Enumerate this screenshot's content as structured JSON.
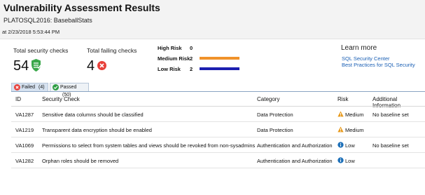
{
  "header": {
    "title": "Vulnerability Assessment Results",
    "database": "PLATOSQL2016: BaseballStats",
    "timestamp": "at 2/23/2018 5:53:44 PM"
  },
  "summary": {
    "total_checks_label": "Total security checks",
    "total_checks_value": "54",
    "failing_checks_label": "Total failing checks",
    "failing_checks_value": "4"
  },
  "risk_summary": [
    {
      "label": "High Risk",
      "count": "0",
      "color": "#e38a1e",
      "fraction": 0
    },
    {
      "label": "Medium Risk",
      "count": "2",
      "color": "#f0922a",
      "fraction": 1
    },
    {
      "label": "Low Risk",
      "count": "2",
      "color": "#1c1fb0",
      "fraction": 1
    }
  ],
  "learn_more": {
    "title": "Learn more",
    "links": [
      "SQL Security Center",
      "Best Practices for SQL Security"
    ]
  },
  "tabs": [
    {
      "label": "Failed",
      "count": "(4)",
      "icon": "fail-icon",
      "active": true
    },
    {
      "label": "Passed",
      "count": "(50)",
      "icon": "pass-icon",
      "active": false
    }
  ],
  "table": {
    "columns": [
      "ID",
      "Security Check",
      "Category",
      "Risk",
      "Additional Information"
    ],
    "rows": [
      {
        "id": "VA1287",
        "check": "Sensitive data columns should be classified",
        "category": "Data Protection",
        "risk": "Medium",
        "risk_icon": "warning-icon",
        "info": "No baseline set"
      },
      {
        "id": "VA1219",
        "check": "Transparent data encryption should be enabled",
        "category": "Data Protection",
        "risk": "Medium",
        "risk_icon": "warning-icon",
        "info": ""
      },
      {
        "id": "VA1069",
        "check": "Permissions to select from system tables and views should be revoked from non-sysadmins",
        "category": "Authentication and Authorization",
        "risk": "Low",
        "risk_icon": "info-icon",
        "info": "No baseline set"
      },
      {
        "id": "VA1282",
        "check": "Orphan roles should be removed",
        "category": "Authentication and Authorization",
        "risk": "Low",
        "risk_icon": "info-icon",
        "info": ""
      }
    ]
  },
  "colors": {
    "accent": "#1a5fb4",
    "fail": "#e8403a",
    "pass": "#2e9e44",
    "warning": "#e89a1c",
    "info": "#1c6fb8"
  }
}
